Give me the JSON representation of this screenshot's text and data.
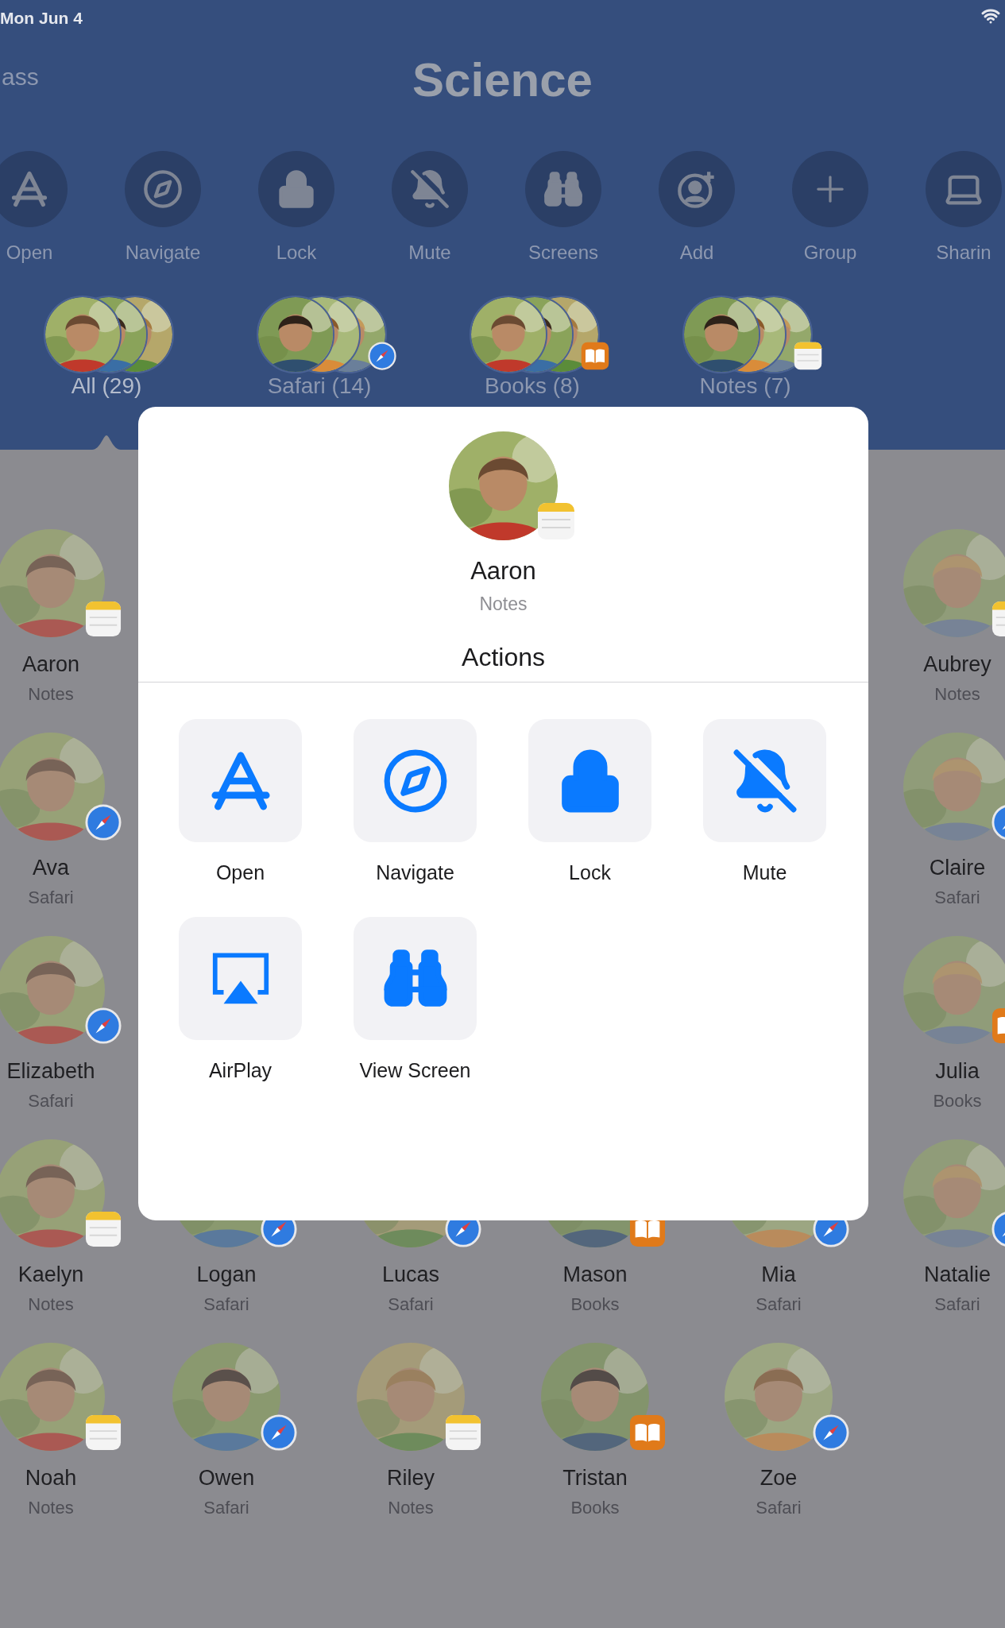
{
  "status_bar": {
    "time": "Mon Jun 4"
  },
  "nav": {
    "back": "ass",
    "title": "Science"
  },
  "toolbar": [
    {
      "label": "Open",
      "kind": "appstore"
    },
    {
      "label": "Navigate",
      "kind": "compass"
    },
    {
      "label": "Lock",
      "kind": "lock"
    },
    {
      "label": "Mute",
      "kind": "mute"
    },
    {
      "label": "Screens",
      "kind": "binoculars"
    },
    {
      "label": "Add",
      "kind": "adduser"
    },
    {
      "label": "Group",
      "kind": "plus"
    },
    {
      "label": "Sharin",
      "kind": "display"
    }
  ],
  "groups": [
    {
      "label": "All (29)",
      "kind": "plain",
      "selected": true
    },
    {
      "label": "Safari (14)",
      "kind": "safari",
      "selected": false
    },
    {
      "label": "Books (8)",
      "kind": "books",
      "selected": false
    },
    {
      "label": "Notes (7)",
      "kind": "notes",
      "selected": false
    }
  ],
  "student_rows": [
    {
      "kind": "edges",
      "students": [
        {
          "name": "Aaron",
          "app": "Notes",
          "kind": "notes"
        },
        {
          "name": "Aubrey",
          "app": "Notes",
          "kind": "notes"
        }
      ]
    },
    {
      "kind": "edges",
      "students": [
        {
          "name": "Ava",
          "app": "Safari",
          "kind": "safari"
        },
        {
          "name": "Claire",
          "app": "Safari",
          "kind": "safari"
        }
      ]
    },
    {
      "kind": "edges",
      "students": [
        {
          "name": "Elizabeth",
          "app": "Safari",
          "kind": "safari"
        },
        {
          "name": "Julia",
          "app": "Books",
          "kind": "books"
        }
      ]
    },
    {
      "kind": "full",
      "students": [
        {
          "name": "Kaelyn",
          "app": "Notes",
          "kind": "notes"
        },
        {
          "name": "Logan",
          "app": "Safari",
          "kind": "safari"
        },
        {
          "name": "Lucas",
          "app": "Safari",
          "kind": "safari"
        },
        {
          "name": "Mason",
          "app": "Books",
          "kind": "books"
        },
        {
          "name": "Mia",
          "app": "Safari",
          "kind": "safari"
        },
        {
          "name": "Natalie",
          "app": "Safari",
          "kind": "safari"
        }
      ]
    },
    {
      "kind": "full",
      "students": [
        {
          "name": "Noah",
          "app": "Notes",
          "kind": "notes"
        },
        {
          "name": "Owen",
          "app": "Safari",
          "kind": "safari"
        },
        {
          "name": "Riley",
          "app": "Notes",
          "kind": "notes"
        },
        {
          "name": "Tristan",
          "app": "Books",
          "kind": "books"
        },
        {
          "name": "Zoe",
          "app": "Safari",
          "kind": "safari"
        }
      ]
    }
  ],
  "dialog": {
    "student": {
      "name": "Aaron",
      "app": "Notes",
      "kind": "notes"
    },
    "heading": "Actions",
    "actions": [
      {
        "label": "Open",
        "kind": "appstore"
      },
      {
        "label": "Navigate",
        "kind": "compass"
      },
      {
        "label": "Lock",
        "kind": "lock"
      },
      {
        "label": "Mute",
        "kind": "mute"
      },
      {
        "label": "AirPlay",
        "kind": "airplay"
      },
      {
        "label": "View Screen",
        "kind": "binoculars"
      }
    ]
  }
}
